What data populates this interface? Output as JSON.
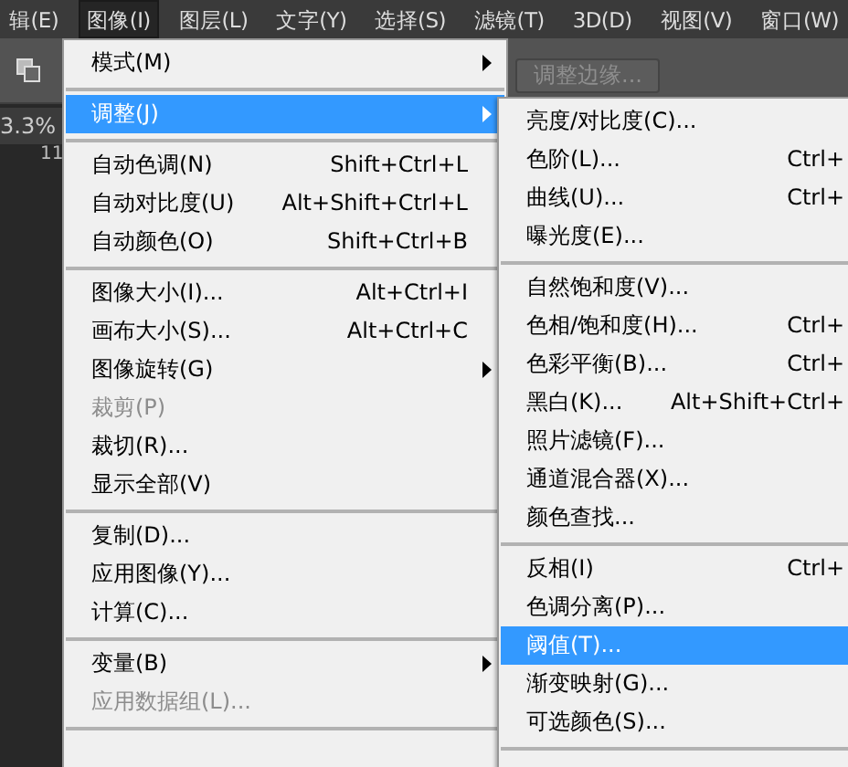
{
  "menubar": [
    {
      "label": "辑(E)",
      "selected": false
    },
    {
      "label": "图像(I)",
      "selected": true
    },
    {
      "label": "图层(L)",
      "selected": false
    },
    {
      "label": "文字(Y)",
      "selected": false
    },
    {
      "label": "选择(S)",
      "selected": false
    },
    {
      "label": "滤镜(T)",
      "selected": false
    },
    {
      "label": "3D(D)",
      "selected": false
    },
    {
      "label": "视图(V)",
      "selected": false
    },
    {
      "label": "窗口(W)",
      "selected": false
    }
  ],
  "options_bar": {
    "button": {
      "label": "调整边缘...",
      "disabled": true
    }
  },
  "zoom_label": "3.3%",
  "ruler_label": "11",
  "menu": [
    {
      "kind": "item",
      "label": "模式(M)",
      "submenu": true,
      "disabled": false,
      "selected": false
    },
    {
      "kind": "separator"
    },
    {
      "kind": "item",
      "label": "调整(J)",
      "submenu": true,
      "disabled": false,
      "selected": true
    },
    {
      "kind": "separator"
    },
    {
      "kind": "item",
      "label": "自动色调(N)",
      "shortcut": "Shift+Ctrl+L",
      "submenu": false,
      "disabled": false,
      "selected": false
    },
    {
      "kind": "item",
      "label": "自动对比度(U)",
      "shortcut": "Alt+Shift+Ctrl+L",
      "submenu": false,
      "disabled": false,
      "selected": false
    },
    {
      "kind": "item",
      "label": "自动颜色(O)",
      "shortcut": "Shift+Ctrl+B",
      "submenu": false,
      "disabled": false,
      "selected": false
    },
    {
      "kind": "separator"
    },
    {
      "kind": "item",
      "label": "图像大小(I)...",
      "shortcut": "Alt+Ctrl+I",
      "submenu": false,
      "disabled": false,
      "selected": false
    },
    {
      "kind": "item",
      "label": "画布大小(S)...",
      "shortcut": "Alt+Ctrl+C",
      "submenu": false,
      "disabled": false,
      "selected": false
    },
    {
      "kind": "item",
      "label": "图像旋转(G)",
      "submenu": true,
      "disabled": false,
      "selected": false
    },
    {
      "kind": "item",
      "label": "裁剪(P)",
      "submenu": false,
      "disabled": true,
      "selected": false
    },
    {
      "kind": "item",
      "label": "裁切(R)...",
      "submenu": false,
      "disabled": false,
      "selected": false
    },
    {
      "kind": "item",
      "label": "显示全部(V)",
      "submenu": false,
      "disabled": false,
      "selected": false
    },
    {
      "kind": "separator"
    },
    {
      "kind": "item",
      "label": "复制(D)...",
      "submenu": false,
      "disabled": false,
      "selected": false
    },
    {
      "kind": "item",
      "label": "应用图像(Y)...",
      "submenu": false,
      "disabled": false,
      "selected": false
    },
    {
      "kind": "item",
      "label": "计算(C)...",
      "submenu": false,
      "disabled": false,
      "selected": false
    },
    {
      "kind": "separator"
    },
    {
      "kind": "item",
      "label": "变量(B)",
      "submenu": true,
      "disabled": false,
      "selected": false
    },
    {
      "kind": "item",
      "label": "应用数据组(L)...",
      "submenu": false,
      "disabled": true,
      "selected": false
    },
    {
      "kind": "separator"
    }
  ],
  "submenu": [
    {
      "kind": "item",
      "label": "亮度/对比度(C)...",
      "selected": false
    },
    {
      "kind": "item",
      "label": "色阶(L)...",
      "shortcut": "Ctrl+",
      "selected": false
    },
    {
      "kind": "item",
      "label": "曲线(U)...",
      "shortcut": "Ctrl+",
      "selected": false
    },
    {
      "kind": "item",
      "label": "曝光度(E)...",
      "selected": false
    },
    {
      "kind": "separator"
    },
    {
      "kind": "item",
      "label": "自然饱和度(V)...",
      "selected": false
    },
    {
      "kind": "item",
      "label": "色相/饱和度(H)...",
      "shortcut": "Ctrl+",
      "selected": false
    },
    {
      "kind": "item",
      "label": "色彩平衡(B)...",
      "shortcut": "Ctrl+",
      "selected": false
    },
    {
      "kind": "item",
      "label": "黑白(K)...",
      "shortcut": "Alt+Shift+Ctrl+",
      "selected": false
    },
    {
      "kind": "item",
      "label": "照片滤镜(F)...",
      "selected": false
    },
    {
      "kind": "item",
      "label": "通道混合器(X)...",
      "selected": false
    },
    {
      "kind": "item",
      "label": "颜色查找...",
      "selected": false
    },
    {
      "kind": "separator"
    },
    {
      "kind": "item",
      "label": "反相(I)",
      "shortcut": "Ctrl+",
      "selected": false
    },
    {
      "kind": "item",
      "label": "色调分离(P)...",
      "selected": false
    },
    {
      "kind": "item",
      "label": "阈值(T)...",
      "selected": true
    },
    {
      "kind": "item",
      "label": "渐变映射(G)...",
      "selected": false
    },
    {
      "kind": "item",
      "label": "可选颜色(S)...",
      "selected": false
    },
    {
      "kind": "separator"
    }
  ]
}
